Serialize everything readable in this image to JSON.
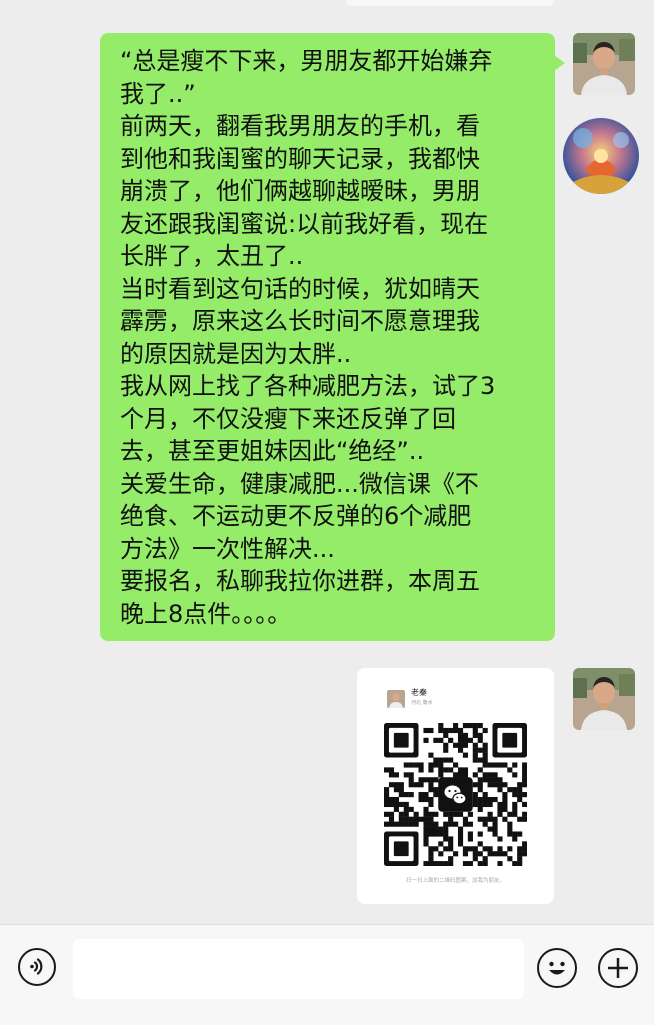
{
  "chat": {
    "bubble_lines": [
      "“总是瘦不下来，男朋友都开始嫌弃",
      "我了..”",
      "前两天，翻看我男朋友的手机，看",
      "到他和我闺蜜的聊天记录，我都快",
      "崩溃了，他们俩越聊越暧昧，男朋",
      "友还跟我闺蜜说:以前我好看，现在",
      "长胖了，太丑了..",
      "当时看到这句话的时候，犹如晴天",
      "霹雳，原来这么长时间不愿意理我",
      "的原因就是因为太胖..",
      "我从网上找了各种减肥方法，试了3",
      "个月，不仅没瘦下来还反弹了回",
      "去，甚至更姐妹因此“绝经”..",
      "关爱生命，健康减肥...微信课《不",
      "绝食、不运动更不反弹的6个减肥",
      "方法》一次性解决...",
      "要报名，私聊我拉你进群，本周五",
      "晚上8点件。。。。"
    ],
    "qr_card": {
      "name": "老秦",
      "location": "河北 衡水",
      "caption": "扫一扫上面的二维码图案，加我为朋友。"
    }
  },
  "input_bar": {
    "placeholder": ""
  },
  "colors": {
    "bubble_green": "#95ec69",
    "background": "#ededed"
  },
  "icons": [
    "voice-icon",
    "emoji-icon",
    "plus-icon",
    "wechat-logo-icon"
  ]
}
